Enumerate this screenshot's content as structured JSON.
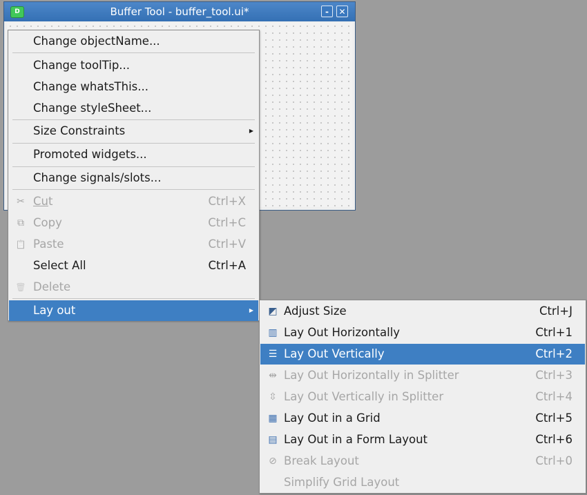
{
  "window": {
    "title": "Buffer Tool - buffer_tool.ui*",
    "app_icon_letter": "D",
    "minimize_glyph": "-",
    "close_glyph": "✕"
  },
  "context_menu": {
    "items": [
      {
        "label": "Change objectName...",
        "shortcut": ""
      },
      {
        "label": "Change toolTip...",
        "shortcut": ""
      },
      {
        "label": "Change whatsThis...",
        "shortcut": ""
      },
      {
        "label": "Change styleSheet...",
        "shortcut": ""
      },
      {
        "label": "Size Constraints",
        "shortcut": "",
        "submenu_arrow": "▶"
      },
      {
        "label": "Promoted widgets...",
        "shortcut": ""
      },
      {
        "label": "Change signals/slots...",
        "shortcut": ""
      },
      {
        "label": "Cut",
        "shortcut": "Ctrl+X",
        "icon": "scissors-icon",
        "glyph": "✂"
      },
      {
        "label": "Copy",
        "shortcut": "Ctrl+C",
        "icon": "copy-icon",
        "glyph": "⧉"
      },
      {
        "label": "Paste",
        "shortcut": "Ctrl+V",
        "icon": "clipboard-icon",
        "glyph": "📋"
      },
      {
        "label": "Select All",
        "shortcut": "Ctrl+A"
      },
      {
        "label": "Delete",
        "shortcut": "",
        "icon": "trash-icon",
        "glyph": "🗑"
      },
      {
        "label": "Lay out",
        "shortcut": "",
        "submenu_arrow": "▶"
      }
    ]
  },
  "layout_submenu": {
    "items": [
      {
        "label": "Adjust Size",
        "shortcut": "Ctrl+J",
        "icon": "adjust-size-icon",
        "glyph": "◩"
      },
      {
        "label": "Lay Out Horizontally",
        "shortcut": "Ctrl+1",
        "icon": "horizontal-layout-icon",
        "glyph": "▥"
      },
      {
        "label": "Lay Out Vertically",
        "shortcut": "Ctrl+2",
        "icon": "vertical-layout-icon",
        "glyph": "☰"
      },
      {
        "label": "Lay Out Horizontally in Splitter",
        "shortcut": "Ctrl+3",
        "icon": "horizontal-splitter-icon",
        "glyph": "⇹"
      },
      {
        "label": "Lay Out Vertically in Splitter",
        "shortcut": "Ctrl+4",
        "icon": "vertical-splitter-icon",
        "glyph": "⇳"
      },
      {
        "label": "Lay Out in a Grid",
        "shortcut": "Ctrl+5",
        "icon": "grid-layout-icon",
        "glyph": "▦"
      },
      {
        "label": "Lay Out in a Form Layout",
        "shortcut": "Ctrl+6",
        "icon": "form-layout-icon",
        "glyph": "▤"
      },
      {
        "label": "Break Layout",
        "shortcut": "Ctrl+0",
        "icon": "break-layout-icon",
        "glyph": "⊘"
      },
      {
        "label": "Simplify Grid Layout",
        "shortcut": ""
      }
    ]
  },
  "colors": {
    "highlight": "#3e7fc3",
    "titlebar": "#3c78bd",
    "disabled_text": "#a6a6a6"
  }
}
